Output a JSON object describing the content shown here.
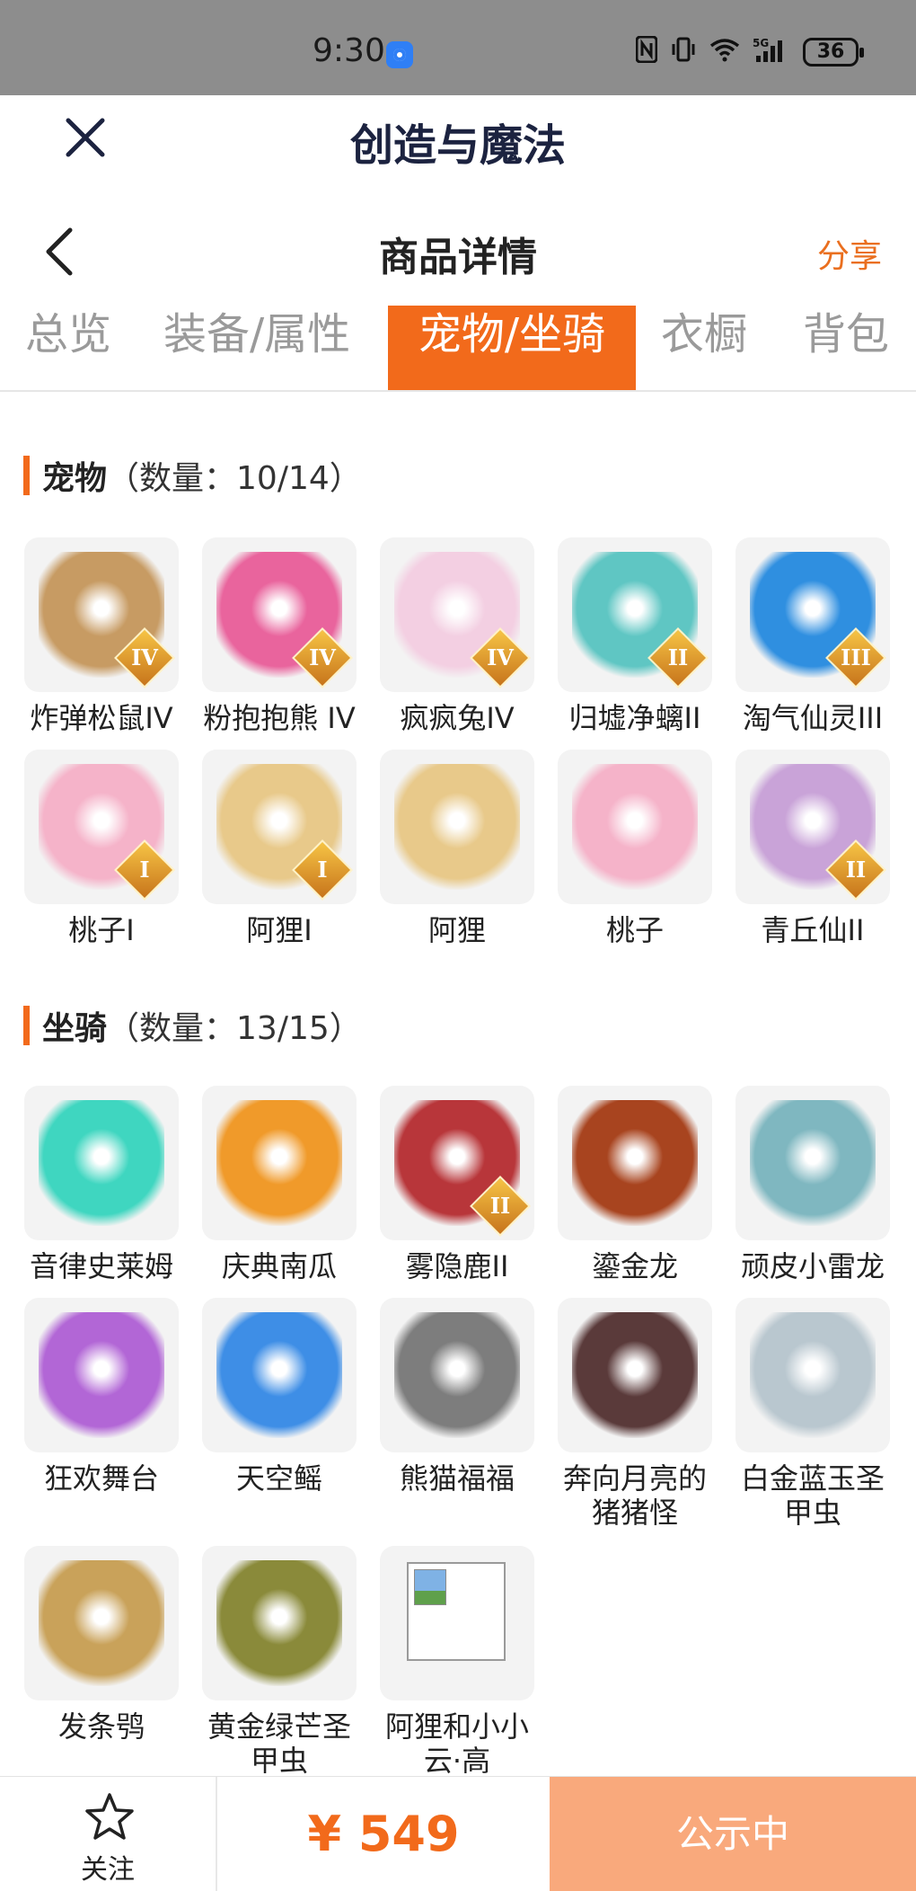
{
  "status_bar": {
    "time": "9:30",
    "icons": [
      "nfc-icon",
      "vibrate-icon",
      "wifi-icon",
      "5g-signal-icon"
    ],
    "network": "5G",
    "battery": "36"
  },
  "app_title": "创造与魔法",
  "nav": {
    "title": "商品详情",
    "share": "分享"
  },
  "tabs": [
    {
      "label": "总览",
      "active": false
    },
    {
      "label": "装备/属性",
      "active": false
    },
    {
      "label": "宠物/坐骑",
      "active": true
    },
    {
      "label": "衣橱",
      "active": false
    },
    {
      "label": "背包",
      "active": false
    }
  ],
  "pets": {
    "title": "宠物",
    "count": "（数量：10/14）",
    "items": [
      {
        "name": "炸弹松鼠IV",
        "badge": "IV",
        "color": "#c79b63"
      },
      {
        "name": "粉抱抱熊 IV",
        "badge": "IV",
        "color": "#e9649d"
      },
      {
        "name": "疯疯兔IV",
        "badge": "IV",
        "color": "#f3cfe2"
      },
      {
        "name": "归墟净螭II",
        "badge": "II",
        "color": "#5fc6c3"
      },
      {
        "name": "淘气仙灵III",
        "badge": "III",
        "color": "#2f8fe0"
      },
      {
        "name": "桃子I",
        "badge": "I",
        "color": "#f5b3c9"
      },
      {
        "name": "阿狸I",
        "badge": "I",
        "color": "#e8c98a"
      },
      {
        "name": "阿狸",
        "badge": "",
        "color": "#e8c98a"
      },
      {
        "name": "桃子",
        "badge": "",
        "color": "#f5b3c9"
      },
      {
        "name": "青丘仙II",
        "badge": "II",
        "color": "#c9a3d8"
      }
    ]
  },
  "mounts": {
    "title": "坐骑",
    "count": "（数量：13/15）",
    "items": [
      {
        "name": "音律史莱姆",
        "badge": "",
        "color": "#3fd6c0"
      },
      {
        "name": "庆典南瓜",
        "badge": "",
        "color": "#f09a2a"
      },
      {
        "name": "雾隐鹿II",
        "badge": "II",
        "color": "#b8363a"
      },
      {
        "name": "鎏金龙",
        "badge": "",
        "color": "#a8441f"
      },
      {
        "name": "顽皮小雷龙",
        "badge": "",
        "color": "#7fb7c0"
      },
      {
        "name": "狂欢舞台",
        "badge": "",
        "color": "#b266d6"
      },
      {
        "name": "天空鳐",
        "badge": "",
        "color": "#3e8ee6"
      },
      {
        "name": "熊猫福福",
        "badge": "",
        "color": "#7d7d7d"
      },
      {
        "name": "奔向月亮的猪猪怪",
        "badge": "",
        "color": "#5a3a3a"
      },
      {
        "name": "白金蓝玉圣甲虫",
        "badge": "",
        "color": "#b9c7cf"
      },
      {
        "name": "发条鸮",
        "badge": "",
        "color": "#c9a25a"
      },
      {
        "name": "黄金绿芒圣甲虫",
        "badge": "",
        "color": "#8a8a3a"
      },
      {
        "name": "阿狸和小小云·高",
        "badge": "",
        "color": "",
        "broken": true
      }
    ]
  },
  "bottom": {
    "follow": "关注",
    "price": "¥ 549",
    "status": "公示中"
  },
  "colors": {
    "accent": "#f26a1b",
    "status_bg": "#f9a97c",
    "title_navy": "#1c2340"
  }
}
